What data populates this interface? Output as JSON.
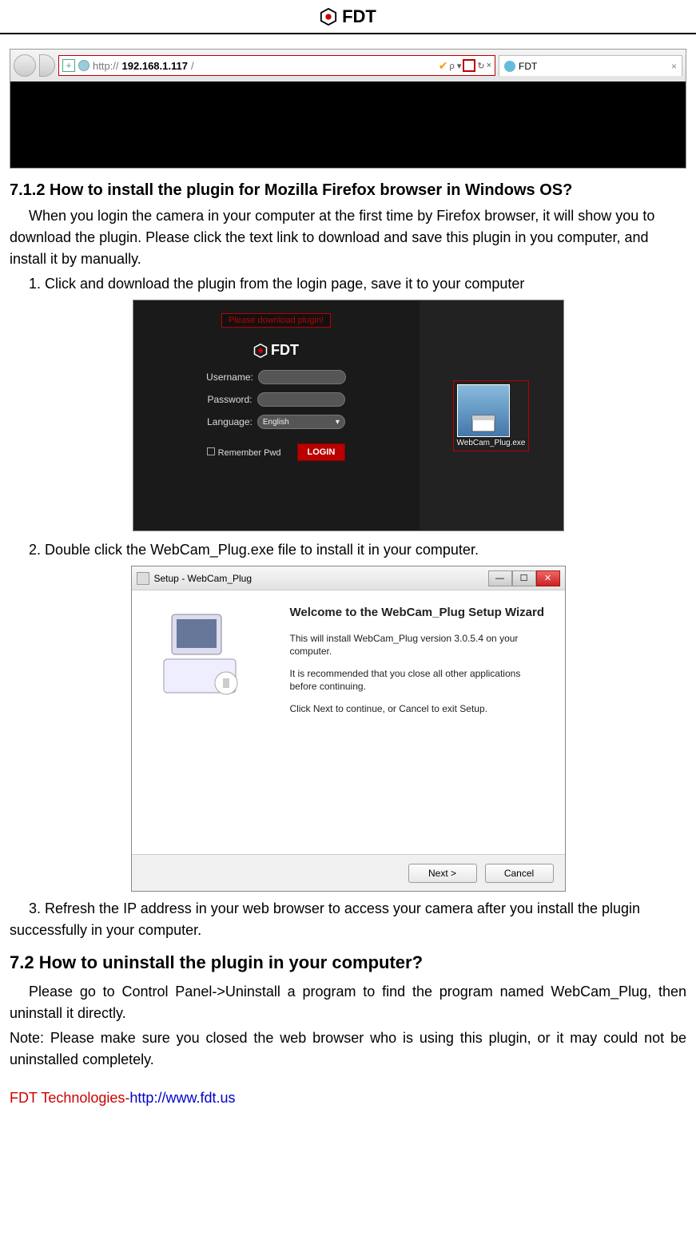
{
  "header": {
    "brand": "FDT"
  },
  "ie_bar": {
    "url_prefix": "http://",
    "url_ip": "192.168.1.117",
    "url_suffix": "/",
    "tab_title": "FDT"
  },
  "section_712_title": "7.1.2 How to install the plugin for Mozilla Firefox browser in Windows OS?",
  "section_712_intro": "When you login the camera in your computer at the first time by Firefox browser, it will show you to download the plugin. Please click the text link to download and save this plugin in you computer, and install it by manually.",
  "step1": "1. Click and download the plugin from the login page, save it to your computer",
  "login_fig": {
    "download_text": "Please download plugin!",
    "brand": "FDT",
    "username_label": "Username:",
    "password_label": "Password:",
    "language_label": "Language:",
    "language_value": "English",
    "remember_label": "Remember Pwd",
    "login_btn": "LOGIN",
    "exe_label": "WebCam_Plug.exe"
  },
  "step2": "2. Double click the WebCam_Plug.exe file to install it in your computer.",
  "setup_fig": {
    "window_title": "Setup - WebCam_Plug",
    "heading": "Welcome to the WebCam_Plug Setup Wizard",
    "p1": "This will install WebCam_Plug version 3.0.5.4 on your computer.",
    "p2": "It is recommended that you close all other applications before continuing.",
    "p3": "Click Next to continue, or Cancel to exit Setup.",
    "next_btn": "Next >",
    "cancel_btn": "Cancel"
  },
  "step3": "3. Refresh the IP address in your web browser to access your camera after you install the plugin successfully in your computer.",
  "section_72_title": "7.2 How to uninstall the plugin in your computer?",
  "section_72_p1": "Please go to Control Panel->Uninstall a program to find the program named WebCam_Plug, then uninstall it directly.",
  "section_72_p2": "Note: Please make sure you closed the web browser who is using this plugin, or it may could not be uninstalled completely.",
  "footer": {
    "company": "FDT Technologies-",
    "link": "http://www.fdt.us"
  }
}
